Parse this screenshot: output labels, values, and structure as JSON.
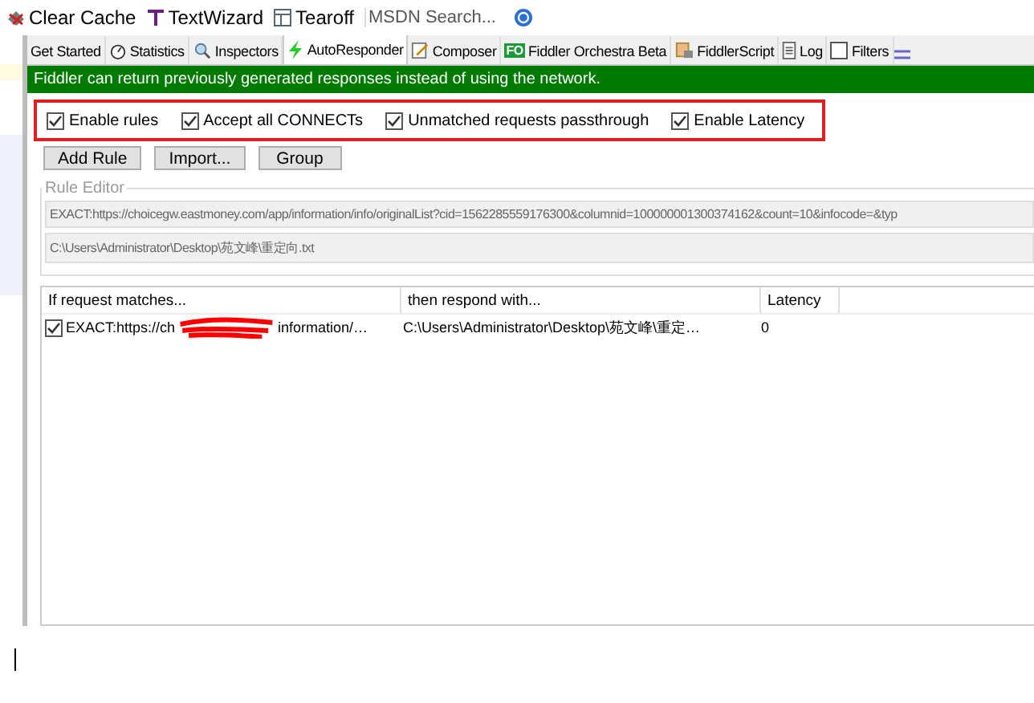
{
  "toolbar": [
    {
      "kind": "clear",
      "label": "Clear Cache"
    },
    {
      "kind": "wizard",
      "label": "TextWizard"
    },
    {
      "kind": "tearoff",
      "label": "Tearoff"
    }
  ],
  "search": {
    "placeholder": "MSDN Search..."
  },
  "tabs": [
    {
      "kind": "plain",
      "label": "Get Started",
      "selected": false
    },
    {
      "kind": "stopwatch",
      "label": "Statistics",
      "selected": false
    },
    {
      "kind": "inspect",
      "label": "Inspectors",
      "selected": false
    },
    {
      "kind": "bolt",
      "label": "AutoResponder",
      "selected": true
    },
    {
      "kind": "compose",
      "label": "Composer",
      "selected": false
    },
    {
      "kind": "fo",
      "label": "Fiddler Orchestra Beta",
      "selected": false
    },
    {
      "kind": "script",
      "label": "FiddlerScript",
      "selected": false
    },
    {
      "kind": "log",
      "label": "Log",
      "selected": false
    },
    {
      "kind": "filter",
      "label": "Filters",
      "selected": false
    }
  ],
  "fo_badge": "FO",
  "banner": "Fiddler can return previously generated responses instead of using the network.",
  "options": [
    {
      "label": "Enable rules",
      "checked": true
    },
    {
      "label": "Accept all CONNECTs",
      "checked": true
    },
    {
      "label": "Unmatched requests passthrough",
      "checked": true
    },
    {
      "label": "Enable Latency",
      "checked": true
    }
  ],
  "buttons": [
    "Add Rule",
    "Import...",
    "Group"
  ],
  "rule_editor": {
    "title": "Rule Editor",
    "match": "EXACT:https://choicegw.eastmoney.com/app/information/info/originalList?cid=1562285559176300&columnid=100000001300374162&count=10&infocode=&typ",
    "response": "C:\\Users\\Administrator\\Desktop\\苑文峰\\重定向.txt"
  },
  "table": {
    "columns": [
      "If request matches...",
      "then respond with...",
      "Latency"
    ],
    "rows": [
      {
        "checked": true,
        "match_start": "EXACT:https://ch",
        "match_end": "information/…",
        "response": "C:\\Users\\Administrator\\Desktop\\苑文峰\\重定…",
        "latency": "0"
      }
    ]
  }
}
